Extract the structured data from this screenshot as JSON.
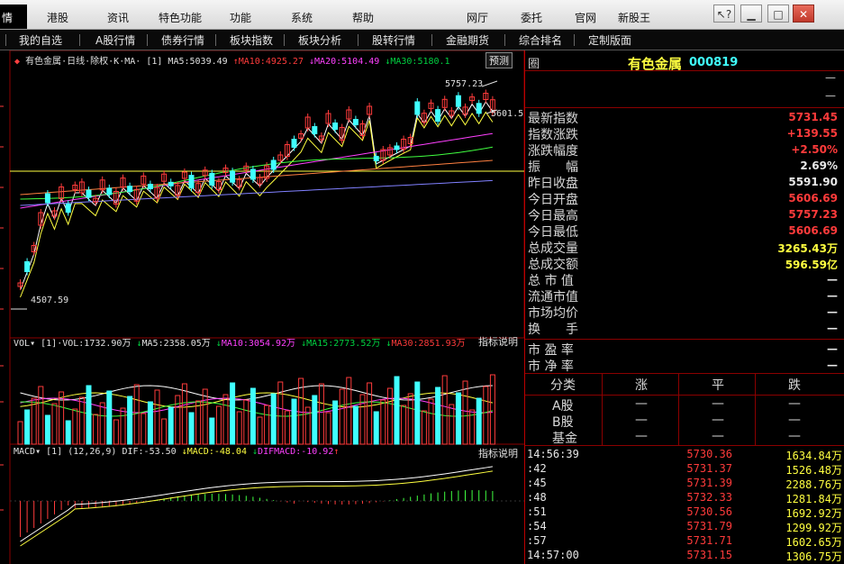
{
  "menu": {
    "active_tab": "情",
    "left_items": [
      "港股",
      "资讯",
      "特色功能",
      "功能",
      "系统",
      "帮助"
    ],
    "right_items": [
      "网厅",
      "委托",
      "官网",
      "新股王"
    ],
    "window_buttons": [
      "help-arrow",
      "minimize",
      "restore",
      "close"
    ]
  },
  "nav": {
    "items": [
      "我的自选",
      "A股行情",
      "债券行情",
      "板块指数",
      "板块分析",
      "股转行情",
      "金融期货",
      "综合排名",
      "定制版面"
    ]
  },
  "kline": {
    "name": "有色金属",
    "period": "日线",
    "adjust": "除权",
    "type": "K",
    "ma_label": "MA",
    "param": "[1]",
    "ma5": "MA5:5039.49",
    "ma10": "MA10:4925.27",
    "ma20": "MA20:5104.49",
    "ma30": "MA30:5180.1",
    "forecast_btn": "预测",
    "high_label": "5757.23",
    "low_label": "4507.59",
    "partial_label": "5601.5"
  },
  "volume": {
    "title": "VOL",
    "param": "[1]",
    "vol": "VOL:1732.90万",
    "ma5": "MA5:2358.05万",
    "ma10": "MA10:3054.92万",
    "ma15": "MA15:2773.52万",
    "ma30": "MA30:2851.93万",
    "help": "指标说明"
  },
  "macd": {
    "title": "MACD",
    "param": "[1]",
    "args": "(12,26,9)",
    "dif": "DIF:-53.50",
    "macd": "MACD:-48.04",
    "difmacd": "DIFMACD:-10.92",
    "help": "指标说明"
  },
  "quote": {
    "icon_char": "圈",
    "title": "有色金属",
    "code": "000819",
    "dash": "—",
    "rows": [
      {
        "label": "最新指数",
        "value": "5731.45",
        "color": "#ff3b3b"
      },
      {
        "label": "指数涨跌",
        "value": "+139.55",
        "color": "#ff3b3b"
      },
      {
        "label": "涨跌幅度",
        "value": "+2.50%",
        "color": "#ff3b3b"
      },
      {
        "label": "振　　幅",
        "value": "2.69%",
        "color": "#e8e8e8"
      },
      {
        "label": "昨日收盘",
        "value": "5591.90",
        "color": "#e8e8e8"
      },
      {
        "label": "今日开盘",
        "value": "5606.69",
        "color": "#ff3b3b"
      },
      {
        "label": "今日最高",
        "value": "5757.23",
        "color": "#ff3b3b"
      },
      {
        "label": "今日最低",
        "value": "5606.69",
        "color": "#ff3b3b"
      },
      {
        "label": "总成交量",
        "value": "3265.43万",
        "color": "#ffff40"
      },
      {
        "label": "总成交额",
        "value": "596.59亿",
        "color": "#ffff40"
      },
      {
        "label": "总 市 值",
        "value": "—",
        "color": "#e8e8e8"
      },
      {
        "label": "流通市值",
        "value": "—",
        "color": "#e8e8e8"
      },
      {
        "label": "市场均价",
        "value": "—",
        "color": "#e8e8e8"
      },
      {
        "label": "换　　手",
        "value": "—",
        "color": "#e8e8e8"
      }
    ],
    "pe_label": "市 盈 率",
    "pe_value": "—",
    "pb_label": "市 净 率",
    "pb_value": "—"
  },
  "breadth": {
    "headers": [
      "分类",
      "涨",
      "平",
      "跌"
    ],
    "rows": [
      {
        "label": "A股",
        "up": "—",
        "flat": "—",
        "down": "—"
      },
      {
        "label": "B股",
        "up": "—",
        "flat": "—",
        "down": "—"
      },
      {
        "label": "基金",
        "up": "—",
        "flat": "—",
        "down": "—"
      }
    ]
  },
  "ticks": [
    {
      "time": "14:56:39",
      "price": "5730.36",
      "vol": "1634.84万"
    },
    {
      "time": ":42",
      "price": "5731.37",
      "vol": "1526.48万"
    },
    {
      "time": ":45",
      "price": "5731.39",
      "vol": "2288.76万"
    },
    {
      "time": ":48",
      "price": "5732.33",
      "vol": "1281.84万"
    },
    {
      "time": ":51",
      "price": "5730.56",
      "vol": "1692.92万"
    },
    {
      "time": ":54",
      "price": "5731.79",
      "vol": "1299.92万"
    },
    {
      "time": ":57",
      "price": "5731.71",
      "vol": "1602.65万"
    },
    {
      "time": "14:57:00",
      "price": "5731.15",
      "vol": "1306.75万"
    }
  ],
  "colors": {
    "up": "#ff3b3b",
    "down": "#40ffff",
    "ma5": "#ffffff",
    "ma10": "#ffff40",
    "ma20": "#ff40ff",
    "ma30": "#40ff40",
    "ma60": "#ff8040",
    "ma120": "#8080ff",
    "grid": "#8b0000"
  }
}
